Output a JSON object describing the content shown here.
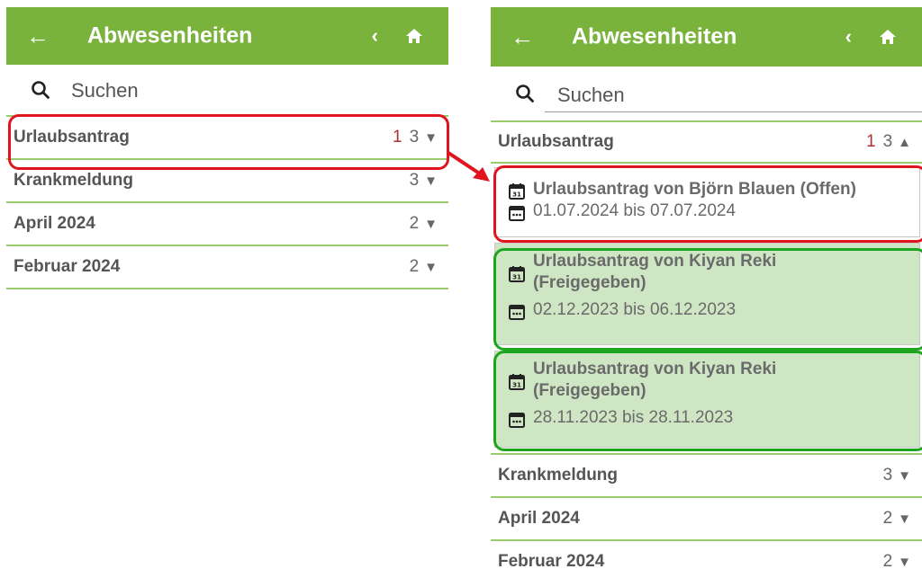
{
  "app": {
    "title": "Abwesenheiten"
  },
  "search": {
    "placeholder": "Suchen"
  },
  "colors": {
    "appbar": "#7ab33c",
    "highlight_red": "#e0141e",
    "highlight_green": "#1ea51e",
    "entry_green": "#cfe6c4",
    "open_count": "#a33333"
  },
  "left": {
    "groups": [
      {
        "label": "Urlaubsantrag",
        "open": "1",
        "total": "3",
        "arrow": "▼"
      },
      {
        "label": "Krankmeldung",
        "total": "3",
        "arrow": "▼"
      },
      {
        "label": "April 2024",
        "total": "2",
        "arrow": "▼"
      },
      {
        "label": "Februar 2024",
        "total": "2",
        "arrow": "▼"
      }
    ]
  },
  "right": {
    "expanded": {
      "label": "Urlaubsantrag",
      "open": "1",
      "total": "3",
      "arrow": "▲"
    },
    "entries": [
      {
        "title": "Urlaubsantrag von Björn Blauen (Offen)",
        "dates": "01.07.2024 bis 07.07.2024"
      },
      {
        "title": "Urlaubsantrag von Kiyan Reki (Freigegeben)",
        "dates": "02.12.2023 bis 06.12.2023"
      },
      {
        "title": "Urlaubsantrag von Kiyan Reki (Freigegeben)",
        "dates": "28.11.2023 bis 28.11.2023"
      }
    ],
    "groups": [
      {
        "label": "Krankmeldung",
        "total": "3",
        "arrow": "▼"
      },
      {
        "label": "April 2024",
        "total": "2",
        "arrow": "▼"
      },
      {
        "label": "Februar 2024",
        "total": "2",
        "arrow": "▼"
      }
    ]
  },
  "icons": {
    "back": "arrow-left-icon",
    "prev": "chevron-left-icon",
    "home": "home-icon",
    "search": "search-icon",
    "calendar": "calendar-icon"
  }
}
